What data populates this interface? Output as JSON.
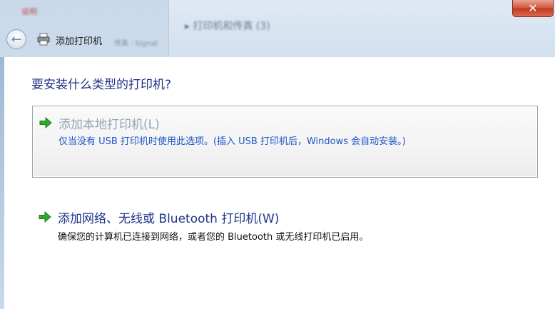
{
  "background": {
    "title": "说明",
    "panel_text": "▸ 打印机和传真 (3)",
    "crumb": "传真 · Signat"
  },
  "close_button": {
    "label": "✕"
  },
  "nav": {
    "back_glyph": "←",
    "window_title": "添加打印机"
  },
  "question": "要安装什么类型的打印机?",
  "options": [
    {
      "title": "添加本地打印机(L)",
      "description": "仅当没有 USB 打印机时使用此选项。(插入 USB 打印机后，Windows 会自动安装。)",
      "selected": true
    },
    {
      "title": "添加网络、无线或 Bluetooth 打印机(W)",
      "description": "确保您的计算机已连接到网络，或者您的 Bluetooth 或无线打印机已启用。",
      "selected": false
    }
  ],
  "colors": {
    "heading": "#1e3287",
    "link_blue": "#1d56c8",
    "disabled_title": "#94a4b8",
    "arrow_green": "#2faa2f",
    "close_red": "#c2391f"
  },
  "icons": {
    "back": "back-arrow-icon",
    "printer": "printer-icon",
    "option_arrow": "green-arrow-icon",
    "close": "close-icon"
  }
}
